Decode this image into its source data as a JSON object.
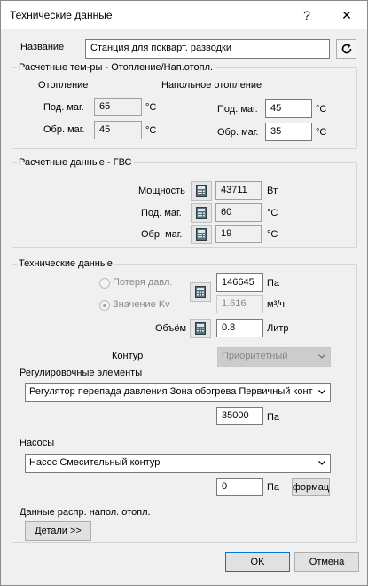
{
  "window": {
    "title": "Технические данные",
    "help": "?",
    "close": "✕"
  },
  "name_row": {
    "label": "Название",
    "value": "Станция для покварт. разводки"
  },
  "design_temps": {
    "group_label": "Расчетные тем-ры - Отопление/Нап.отопл.",
    "heating": {
      "label": "Отопление",
      "supply_label": "Под. маг.",
      "supply": "65",
      "return_label": "Обр. маг.",
      "return": "45",
      "unit": "°C"
    },
    "floor": {
      "label": "Напольное отопление",
      "supply_label": "Под. маг.",
      "supply": "45",
      "return_label": "Обр. маг.",
      "return": "35",
      "unit": "°C"
    }
  },
  "dhw": {
    "group_label": "Расчетные данные - ГВС",
    "power_label": "Мощность",
    "power": "43711",
    "power_unit": "Вт",
    "supply_label": "Под. маг.",
    "supply": "60",
    "supply_unit": "°C",
    "return_label": "Обр. маг.",
    "return": "19",
    "return_unit": "°C"
  },
  "tech": {
    "group_label": "Технические данные",
    "pressure_loss_label": "Потеря давл.",
    "pressure_loss": "146645",
    "pressure_unit": "Па",
    "kv_label": "Значение Kv",
    "kv": "1.616",
    "kv_unit": "м³/ч",
    "volume_label": "Объём",
    "volume": "0.8",
    "volume_unit": "Литр",
    "circuit_label": "Контур",
    "circuit_value": "Приоритетный",
    "control_label": "Регулировочные элементы",
    "control_value": "Регулятор перепада давления Зона обогрева Первичный конт",
    "control_pressure": "35000",
    "control_unit": "Па",
    "pumps_label": "Насосы",
    "pump_value": "Насос Смесительный контур",
    "pump_pressure": "0",
    "pump_unit": "Па",
    "formula_button": "формац",
    "distribution_label": "Данные распр. напол. отопл.",
    "details_button": "Детали >>"
  },
  "footer": {
    "ok": "OK",
    "cancel": "Отмена"
  }
}
